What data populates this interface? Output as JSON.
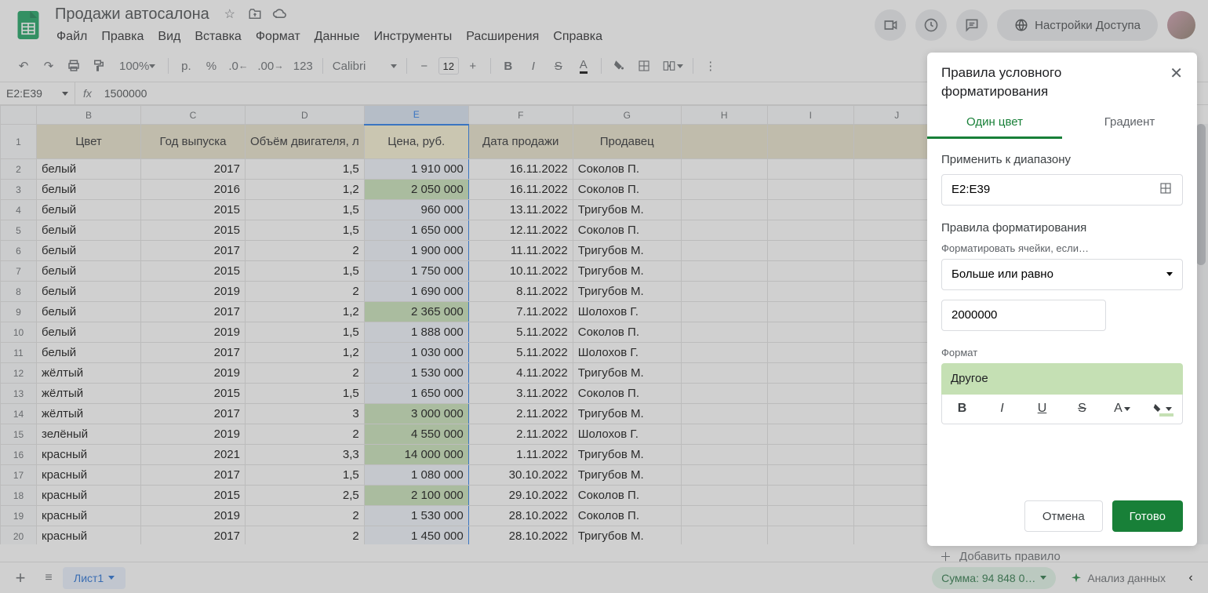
{
  "doc": {
    "title": "Продажи автосалона"
  },
  "menu": {
    "file": "Файл",
    "edit": "Правка",
    "view": "Вид",
    "insert": "Вставка",
    "format": "Формат",
    "data": "Данные",
    "tools": "Инструменты",
    "extensions": "Расширения",
    "help": "Справка"
  },
  "toolbar": {
    "zoom": "100%",
    "currency": "р.",
    "percent": "%",
    "dec_dec": ".0",
    "inc_dec": ".00",
    "numfmt": "123",
    "font": "Calibri",
    "font_size": "12"
  },
  "namebox": "E2:E39",
  "formula": "1500000",
  "columns": [
    "B",
    "C",
    "D",
    "E",
    "F",
    "G",
    "H",
    "I",
    "J"
  ],
  "headers": {
    "B": "Цвет",
    "C": "Год выпуска",
    "D": "Объём двигателя, л",
    "E": "Цена, руб.",
    "F": "Дата продажи",
    "G": "Продавец"
  },
  "rows": [
    {
      "n": 2,
      "B": "белый",
      "C": "2017",
      "D": "1,5",
      "E": "1 910 000",
      "F": "16.11.2022",
      "G": "Соколов П.",
      "hl": false
    },
    {
      "n": 3,
      "B": "белый",
      "C": "2016",
      "D": "1,2",
      "E": "2 050 000",
      "F": "16.11.2022",
      "G": "Соколов П.",
      "hl": true
    },
    {
      "n": 4,
      "B": "белый",
      "C": "2015",
      "D": "1,5",
      "E": "960 000",
      "F": "13.11.2022",
      "G": "Тригубов М.",
      "hl": false
    },
    {
      "n": 5,
      "B": "белый",
      "C": "2015",
      "D": "1,5",
      "E": "1 650 000",
      "F": "12.11.2022",
      "G": "Соколов П.",
      "hl": false
    },
    {
      "n": 6,
      "B": "белый",
      "C": "2017",
      "D": "2",
      "E": "1 900 000",
      "F": "11.11.2022",
      "G": "Тригубов М.",
      "hl": false
    },
    {
      "n": 7,
      "B": "белый",
      "C": "2015",
      "D": "1,5",
      "E": "1 750 000",
      "F": "10.11.2022",
      "G": "Тригубов М.",
      "hl": false
    },
    {
      "n": 8,
      "B": "белый",
      "C": "2019",
      "D": "2",
      "E": "1 690 000",
      "F": "8.11.2022",
      "G": "Тригубов М.",
      "hl": false
    },
    {
      "n": 9,
      "B": "белый",
      "C": "2017",
      "D": "1,2",
      "E": "2 365 000",
      "F": "7.11.2022",
      "G": "Шолохов Г.",
      "hl": true
    },
    {
      "n": 10,
      "B": "белый",
      "C": "2019",
      "D": "1,5",
      "E": "1 888 000",
      "F": "5.11.2022",
      "G": "Соколов П.",
      "hl": false
    },
    {
      "n": 11,
      "B": "белый",
      "C": "2017",
      "D": "1,2",
      "E": "1 030 000",
      "F": "5.11.2022",
      "G": "Шолохов Г.",
      "hl": false
    },
    {
      "n": 12,
      "B": "жёлтый",
      "C": "2019",
      "D": "2",
      "E": "1 530 000",
      "F": "4.11.2022",
      "G": "Тригубов М.",
      "hl": false
    },
    {
      "n": 13,
      "B": "жёлтый",
      "C": "2015",
      "D": "1,5",
      "E": "1 650 000",
      "F": "3.11.2022",
      "G": "Соколов П.",
      "hl": false
    },
    {
      "n": 14,
      "B": "жёлтый",
      "C": "2017",
      "D": "3",
      "E": "3 000 000",
      "F": "2.11.2022",
      "G": "Тригубов М.",
      "hl": true
    },
    {
      "n": 15,
      "B": "зелёный",
      "C": "2019",
      "D": "2",
      "E": "4 550 000",
      "F": "2.11.2022",
      "G": "Шолохов Г.",
      "hl": true
    },
    {
      "n": 16,
      "B": "красный",
      "C": "2021",
      "D": "3,3",
      "E": "14 000 000",
      "F": "1.11.2022",
      "G": "Тригубов М.",
      "hl": true
    },
    {
      "n": 17,
      "B": "красный",
      "C": "2017",
      "D": "1,5",
      "E": "1 080 000",
      "F": "30.10.2022",
      "G": "Тригубов М.",
      "hl": false
    },
    {
      "n": 18,
      "B": "красный",
      "C": "2015",
      "D": "2,5",
      "E": "2 100 000",
      "F": "29.10.2022",
      "G": "Соколов П.",
      "hl": true
    },
    {
      "n": 19,
      "B": "красный",
      "C": "2019",
      "D": "2",
      "E": "1 530 000",
      "F": "28.10.2022",
      "G": "Соколов П.",
      "hl": false
    },
    {
      "n": 20,
      "B": "красный",
      "C": "2017",
      "D": "2",
      "E": "1 450 000",
      "F": "28.10.2022",
      "G": "Тригубов М.",
      "hl": false
    }
  ],
  "sidepanel": {
    "title": "Правила условного форматирования",
    "tab_single": "Один цвет",
    "tab_gradient": "Градиент",
    "apply_label": "Применить к диапазону",
    "range": "E2:E39",
    "rules_label": "Правила форматирования",
    "format_if_label": "Форматировать ячейки, если…",
    "condition": "Больше или равно",
    "value": "2000000",
    "format_label": "Формат",
    "preview_text": "Другое",
    "cancel": "Отмена",
    "done": "Готово"
  },
  "share_button": "Настройки Доступа",
  "add_rule": "Добавить правило",
  "status": {
    "sheet": "Лист1",
    "sum": "Сумма: 94 848 0…",
    "analyze": "Анализ данных"
  }
}
